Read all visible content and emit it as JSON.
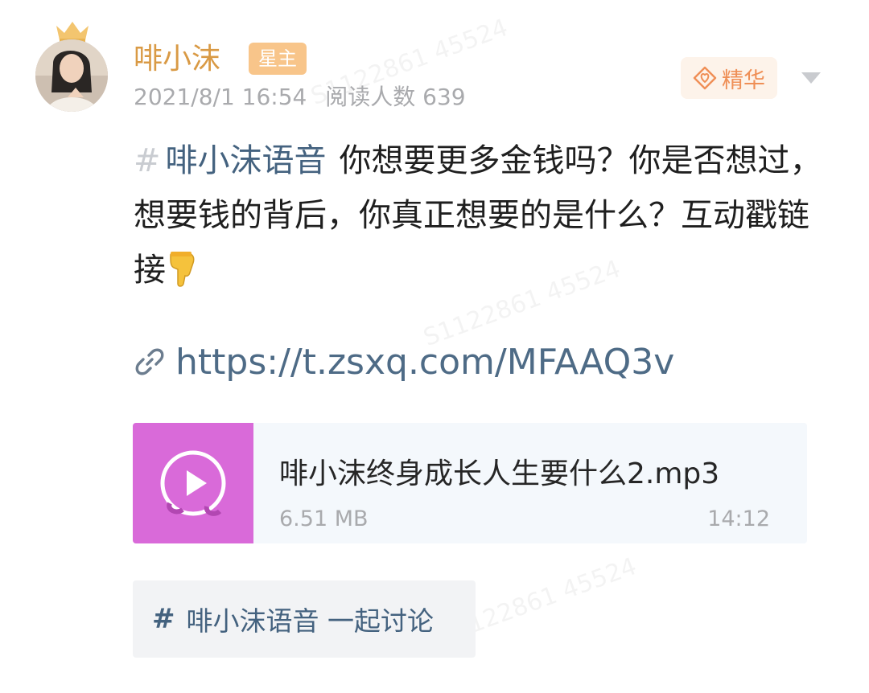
{
  "post": {
    "author": {
      "name": "啡小沫",
      "role_badge": "星主"
    },
    "meta": {
      "timestamp": "2021/8/1 16:54",
      "read_count_label": "阅读人数 639"
    },
    "featured_badge": "精华",
    "body": {
      "hash_symbol": "#",
      "topic": "啡小沫语音",
      "text": "你想要更多金钱吗？你是否想过，想要钱的背后，你真正想要的是什么？互动戳链接"
    },
    "link": {
      "url": "https://t.zsxq.com/MFAAQ3v"
    },
    "attachment": {
      "file_name": "啡小沫终身成长人生要什么2.mp3",
      "file_size": "6.51 MB",
      "duration": "14:12"
    },
    "topic_chip": {
      "hash_symbol": "#",
      "label": "啡小沫语音 一起讨论"
    }
  },
  "colors": {
    "author_name": "#d99a45",
    "role_badge_bg": "#f8c58a",
    "featured_text": "#ef8f56",
    "topic_link": "#44627f",
    "url_link": "#4e6b86",
    "file_thumb_bg": "#d96ad9",
    "meta_gray": "#a9aaad"
  },
  "icons": {
    "crown": "crown-icon",
    "featured": "diamond-heart-icon",
    "more": "chevron-down-icon",
    "finger": "backhand-index-pointing-down-icon",
    "link": "link-icon",
    "audio": "play-music-icon"
  }
}
